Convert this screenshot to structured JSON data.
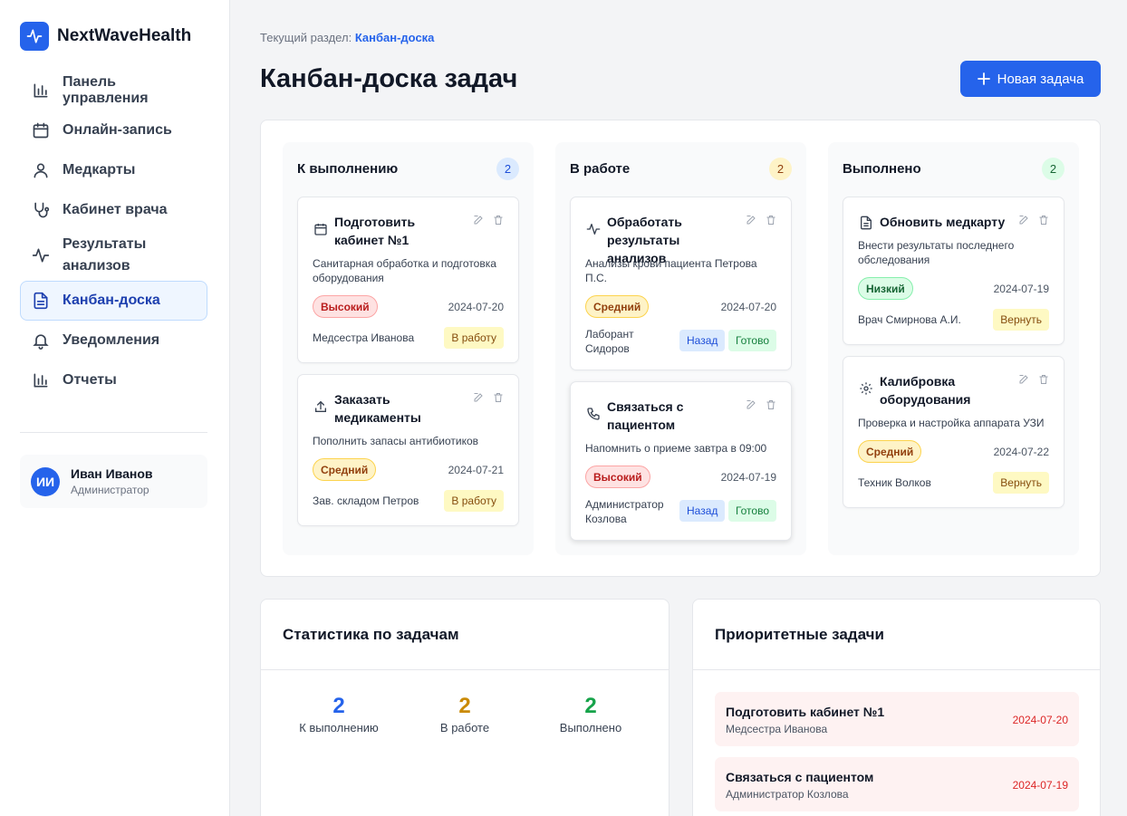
{
  "brand": {
    "name": "NextWaveHealth"
  },
  "sidebar": {
    "items": [
      {
        "label": "Панель управления"
      },
      {
        "label": "Онлайн-запись"
      },
      {
        "label": "Медкарты"
      },
      {
        "label": "Кабинет врача"
      },
      {
        "label": "Результаты анализов"
      },
      {
        "label": "Канбан-доска"
      },
      {
        "label": "Уведомления"
      },
      {
        "label": "Отчеты"
      }
    ],
    "active": "Канбан-доска"
  },
  "user": {
    "initials": "ИИ",
    "name": "Иван Иванов",
    "role": "Администратор"
  },
  "header": {
    "breadcrumb_prefix": "Текущий раздел:",
    "breadcrumb_current": "Канбан-доска",
    "title": "Канбан-доска задач",
    "new_task_label": "Новая задача"
  },
  "board": {
    "columns": [
      {
        "title": "К выполнению",
        "count": "2",
        "cards": [
          {
            "icon": "calendar-icon",
            "title": "Подготовить кабинет №1",
            "desc": "Санитарная обработка и подготовка оборудования",
            "priority": "Высокий",
            "date": "2024-07-20",
            "assignee": "Медсестра Иванова",
            "action": "В работу"
          },
          {
            "icon": "upload-icon",
            "title": "Заказать медикаменты",
            "desc": "Пополнить запасы антибиотиков",
            "priority": "Средний",
            "date": "2024-07-21",
            "assignee": "Зав. складом Петров",
            "action": "В работу"
          }
        ]
      },
      {
        "title": "В работе",
        "count": "2",
        "cards": [
          {
            "icon": "activity-icon",
            "title": "Обработать результаты анализов",
            "desc": "Анализы крови пациента Петрова П.С.",
            "priority": "Средний",
            "date": "2024-07-20",
            "assignee": "Лаборант Сидоров",
            "action_back": "Назад",
            "action_done": "Готово"
          },
          {
            "icon": "phone-icon",
            "title": "Связаться с пациентом",
            "desc": "Напомнить о приеме завтра в 09:00",
            "priority": "Высокий",
            "date": "2024-07-19",
            "assignee": "Администратор Козлова",
            "action_back": "Назад",
            "action_done": "Готово"
          }
        ]
      },
      {
        "title": "Выполнено",
        "count": "2",
        "cards": [
          {
            "icon": "file-icon",
            "title": "Обновить медкарту",
            "desc": "Внести результаты последнего обследования",
            "priority": "Низкий",
            "date": "2024-07-19",
            "assignee": "Врач Смирнова А.И.",
            "action": "Вернуть"
          },
          {
            "icon": "gear-icon",
            "title": "Калибровка оборудования",
            "desc": "Проверка и настройка аппарата УЗИ",
            "priority": "Средний",
            "date": "2024-07-22",
            "assignee": "Техник Волков",
            "action": "Вернуть"
          }
        ]
      }
    ]
  },
  "stats": {
    "title": "Статистика по задачам",
    "items": [
      {
        "value": "2",
        "label": "К выполнению",
        "color": "#2563eb"
      },
      {
        "value": "2",
        "label": "В работе",
        "color": "#ca8a04"
      },
      {
        "value": "2",
        "label": "Выполнено",
        "color": "#16a34a"
      }
    ]
  },
  "priority": {
    "title": "Приоритетные задачи",
    "items": [
      {
        "title": "Подготовить кабинет №1",
        "assignee": "Медсестра Иванова",
        "date": "2024-07-20"
      },
      {
        "title": "Связаться с пациентом",
        "assignee": "Администратор Козлова",
        "date": "2024-07-19"
      }
    ]
  },
  "colors": {
    "accent": "#2563eb",
    "high": "#b91c1c",
    "medium": "#92400e",
    "low": "#166534"
  }
}
